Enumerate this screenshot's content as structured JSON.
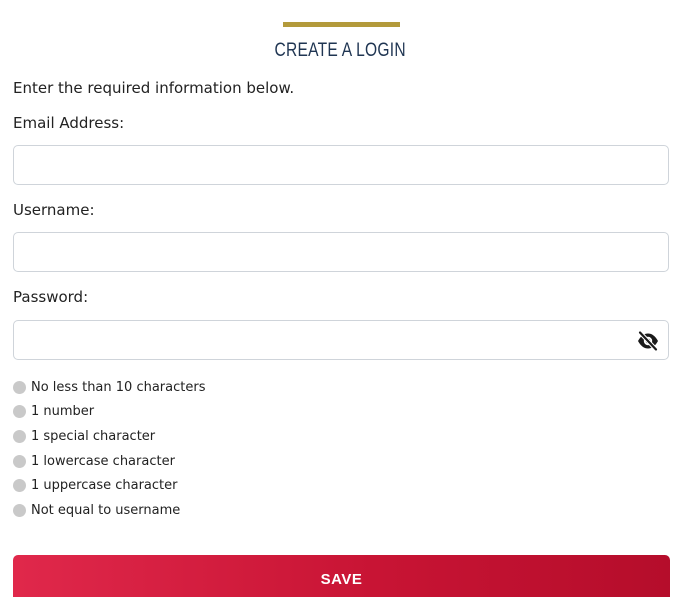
{
  "form": {
    "title": "CREATE A LOGIN",
    "intro": "Enter the required information below.",
    "email": {
      "label": "Email Address:",
      "value": "",
      "placeholder": ""
    },
    "username": {
      "label": "Username:",
      "value": "",
      "placeholder": ""
    },
    "password": {
      "label": "Password:",
      "value": "",
      "placeholder": "",
      "visibility_icon": "eye-slash-icon"
    },
    "password_rules": [
      {
        "label": "No less than 10 characters",
        "met": false
      },
      {
        "label": "1 number",
        "met": false
      },
      {
        "label": "1 special character",
        "met": false
      },
      {
        "label": "1 lowercase character",
        "met": false
      },
      {
        "label": "1 uppercase character",
        "met": false
      },
      {
        "label": "Not equal to username",
        "met": false
      }
    ],
    "save_label": "SAVE"
  },
  "colors": {
    "accent_gold": "#b39a3b",
    "title_navy": "#1f3552",
    "save_red": "#c81434",
    "rule_unmet_gray": "#c9c9c9"
  }
}
